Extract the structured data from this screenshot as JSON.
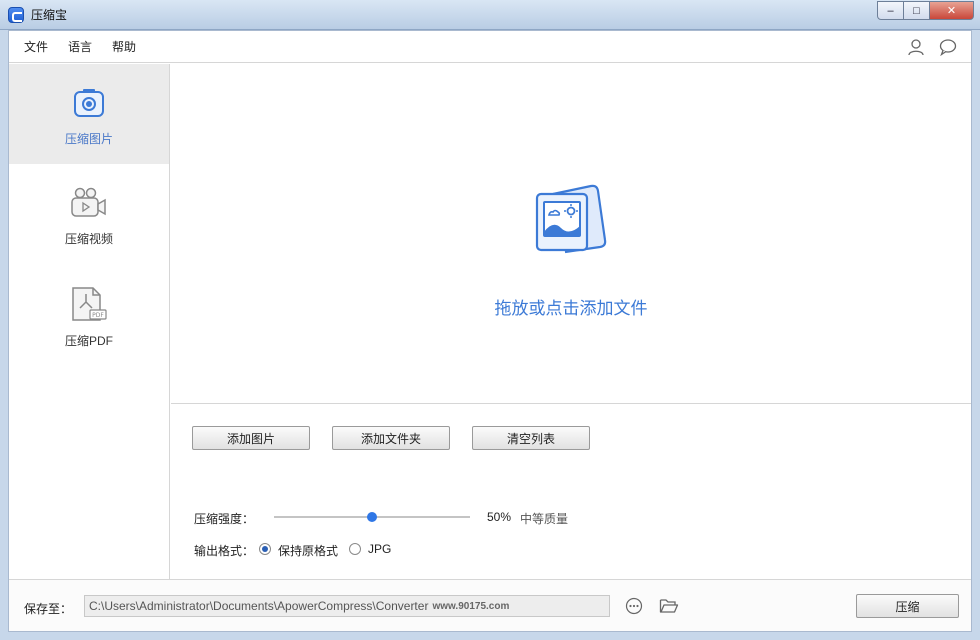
{
  "window": {
    "title": "压缩宝",
    "minimize_glyph": "–",
    "maximize_glyph": "□",
    "close_glyph": "✕"
  },
  "menu": {
    "items": [
      "文件",
      "语言",
      "帮助"
    ],
    "icons": [
      "user-icon",
      "chat-bubble-icon"
    ]
  },
  "sidebar": {
    "items": [
      {
        "label": "压缩图片",
        "icon": "camera-icon",
        "active": true
      },
      {
        "label": "压缩视频",
        "icon": "video-camera-icon",
        "active": false
      },
      {
        "label": "压缩PDF",
        "icon": "pdf-file-icon",
        "active": false
      }
    ]
  },
  "drop": {
    "icon": "image-stack-icon",
    "text": "拖放或点击添加文件"
  },
  "buttons": {
    "add_image": "添加图片",
    "add_folder": "添加文件夹",
    "clear_list": "清空列表",
    "compress": "压缩"
  },
  "compression": {
    "label": "压缩强度：",
    "value_percent": 50,
    "value_text": "50%",
    "quality_text": "中等质量"
  },
  "output_format": {
    "label": "输出格式：",
    "options": [
      {
        "label": "保持原格式",
        "checked": true
      },
      {
        "label": "JPG",
        "checked": false
      }
    ]
  },
  "save": {
    "label": "保存至：",
    "path": "C:\\Users\\Administrator\\Documents\\ApowerCompress\\Converter",
    "watermark": "www.90175.com",
    "icons": [
      "more-options-icon",
      "folder-open-icon"
    ]
  },
  "colors": {
    "accent": "#3c7ad6",
    "slider_thumb": "#2f77e6",
    "active_sidebar_bg": "#ebebeb"
  }
}
